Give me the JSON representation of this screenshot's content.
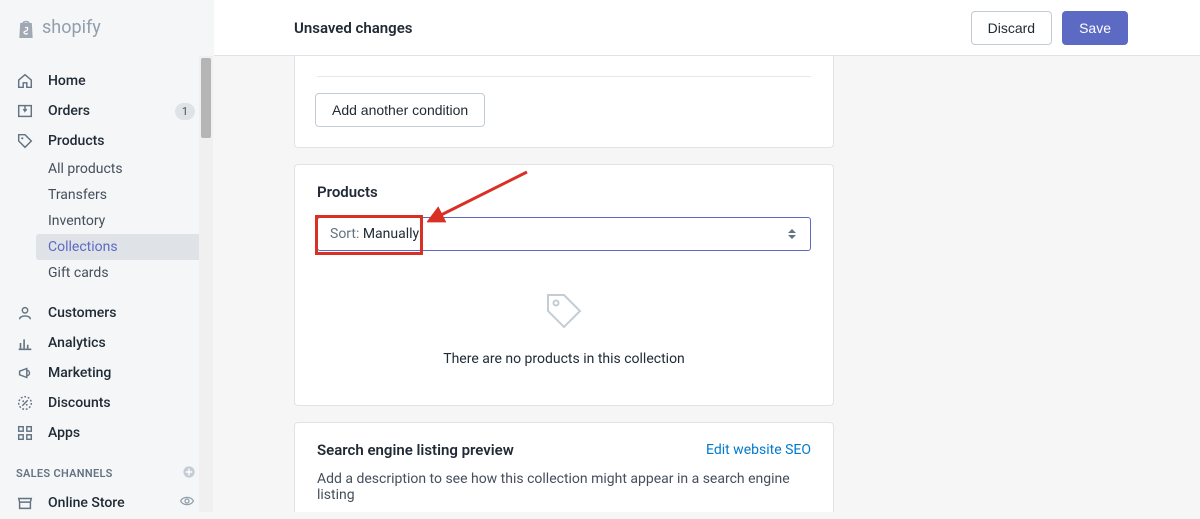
{
  "brand": "shopify",
  "header": {
    "status": "Unsaved changes",
    "discard": "Discard",
    "save": "Save"
  },
  "sidebar": {
    "home": "Home",
    "orders": "Orders",
    "orders_badge": "1",
    "products": "Products",
    "products_sub": {
      "all": "All products",
      "transfers": "Transfers",
      "inventory": "Inventory",
      "collections": "Collections",
      "giftcards": "Gift cards"
    },
    "customers": "Customers",
    "analytics": "Analytics",
    "marketing": "Marketing",
    "discounts": "Discounts",
    "apps": "Apps",
    "sales_channels": "SALES CHANNELS",
    "online_store": "Online Store"
  },
  "main": {
    "add_condition": "Add another condition",
    "products_title": "Products",
    "sort_prefix": "Sort: ",
    "sort_value": "Manually",
    "empty_text": "There are no products in this collection",
    "seo_title": "Search engine listing preview",
    "seo_link": "Edit website SEO",
    "seo_desc": "Add a description to see how this collection might appear in a search engine listing"
  }
}
